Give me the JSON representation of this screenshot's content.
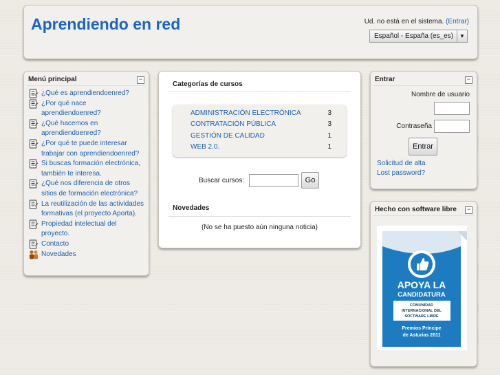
{
  "header": {
    "site_title": "Aprendiendo en red",
    "login_text": "Ud. no está en el sistema.",
    "login_link": "(Entrar)",
    "language_selected": "Español - España (es_es)"
  },
  "menu": {
    "title": "Menú principal",
    "collapse_glyph": "−",
    "items": [
      {
        "label": "¿Qué es aprendiendoenred?",
        "icon": "document-icon"
      },
      {
        "label": "¿Por qué nace aprendiendoenred?",
        "icon": "document-icon"
      },
      {
        "label": "¿Qué hacemos en aprendiendoenred?",
        "icon": "document-icon"
      },
      {
        "label": "¿Por qué te puede interesar trabajar con aprendiendoenred?",
        "icon": "document-icon"
      },
      {
        "label": "Si buscas formación electrónica, también te interesa.",
        "icon": "document-icon"
      },
      {
        "label": "¿Qué nos diferencia de otros sitios de formación electrónica?",
        "icon": "document-icon"
      },
      {
        "label": "La reutilización de las actividades formativas (el proyecto Aporta).",
        "icon": "document-icon"
      },
      {
        "label": "Propiedad intelectual del proyecto.",
        "icon": "document-icon"
      },
      {
        "label": "Contacto",
        "icon": "document-icon"
      },
      {
        "label": "Novedades",
        "icon": "forum-icon"
      }
    ]
  },
  "center": {
    "categories_title": "Categorías de cursos",
    "categories": [
      {
        "name": "ADMINISTRACIÓN ELECTRÓNICA",
        "count": "3"
      },
      {
        "name": "CONTRATACIÓN PÚBLICA",
        "count": "3"
      },
      {
        "name": "GESTIÓN DE CALIDAD",
        "count": "1"
      },
      {
        "name": "WEB 2.0.",
        "count": "1"
      }
    ],
    "search_label": "Buscar cursos:",
    "search_value": "",
    "go_label": "Go",
    "news_title": "Novedades",
    "news_empty": "(No se ha puesto aún ninguna noticia)"
  },
  "login_block": {
    "title": "Entrar",
    "username_label": "Nombre de usuario",
    "password_label": "Contraseña",
    "submit_label": "Entrar",
    "signup_link": "Solicitud de alta",
    "lost_password_link": "Lost password?"
  },
  "free_block": {
    "title": "Hecho con software libre",
    "badge": {
      "line1": "APOYA LA",
      "line2": "CANDIDATURA",
      "line3": "COMUNIDAD",
      "line4": "INTERNACIONAL DEL",
      "line5": "SOFTWARE LIBRE",
      "line6": "Premios Príncipe",
      "line7": "de Asturias 2011"
    }
  },
  "colors": {
    "title_blue": "#1a64c8",
    "link_blue": "#1a5fb4",
    "badge_blue": "#1d7cc0"
  }
}
